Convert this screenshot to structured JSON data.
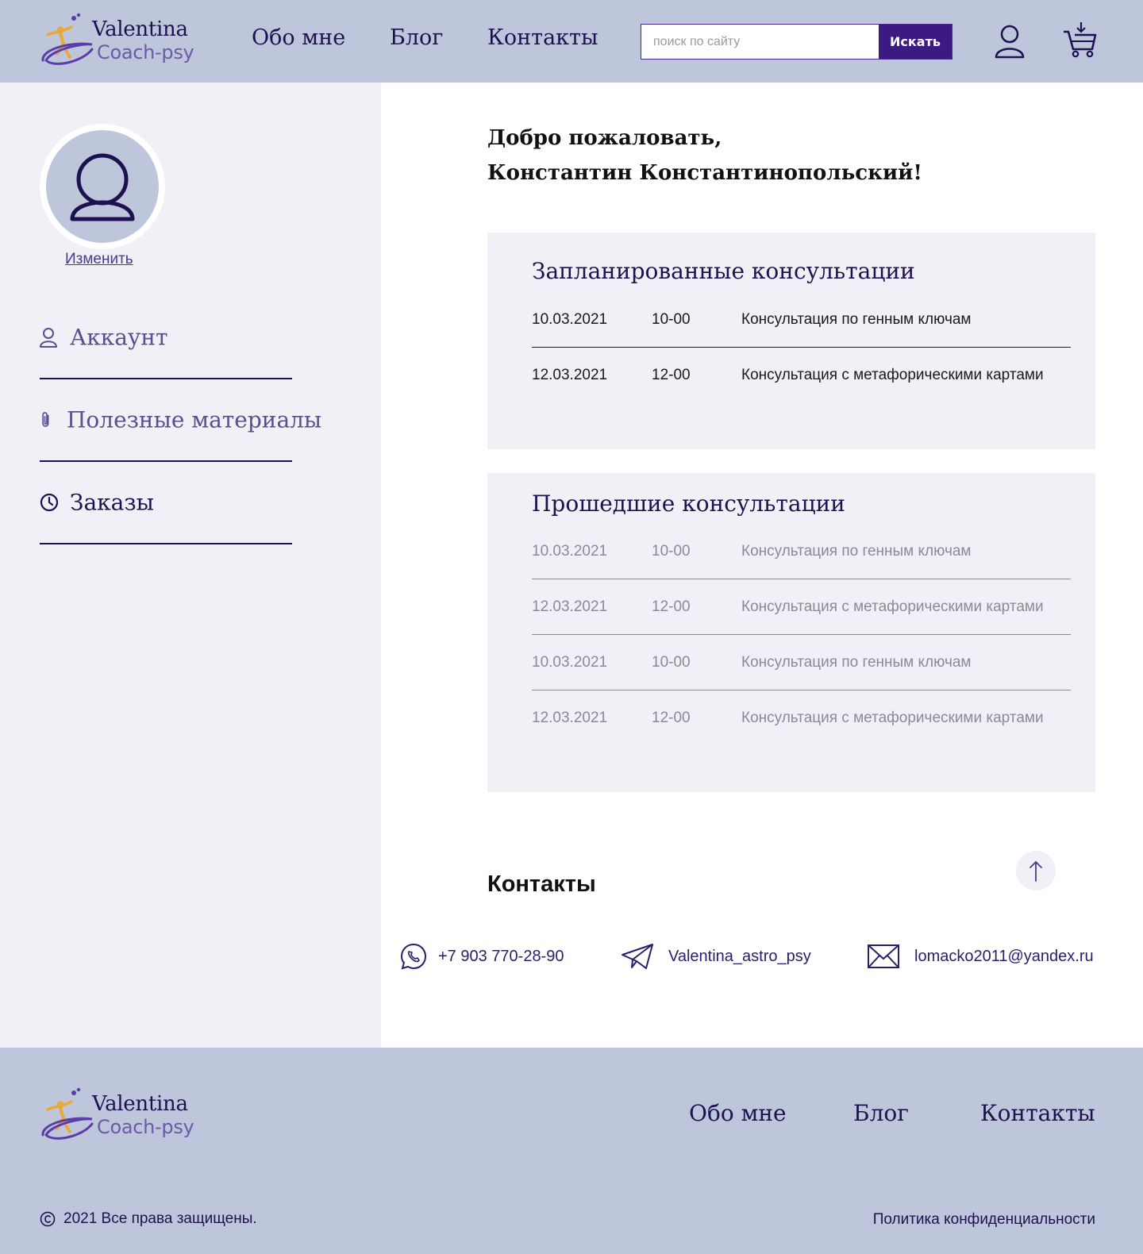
{
  "brand": {
    "line1": "Valentina",
    "line2": "Coach-psy"
  },
  "header": {
    "nav": [
      "Обо мне",
      "Блог",
      "Контакты"
    ],
    "search": {
      "placeholder": "поиск по сайту",
      "button": "Искать"
    },
    "icons": [
      "user-icon",
      "cart-icon"
    ]
  },
  "sidebar": {
    "change_label": "Изменить",
    "items": [
      {
        "label": "Аккаунт",
        "icon": "user-icon"
      },
      {
        "label": "Полезные материалы",
        "icon": "paperclip-icon"
      },
      {
        "label": "Заказы",
        "icon": "clock-icon"
      }
    ]
  },
  "main": {
    "welcome_line1": "Добро пожаловать,",
    "welcome_line2": "Константин Константинопольский!",
    "planned": {
      "title": "Запланированные консультации",
      "rows": [
        {
          "date": "10.03.2021",
          "time": "10-00",
          "name": "Консультация по генным ключам"
        },
        {
          "date": "12.03.2021",
          "time": "12-00",
          "name": "Консультация с метафорическими картами"
        }
      ]
    },
    "past": {
      "title": "Прошедшие консультации",
      "rows": [
        {
          "date": "10.03.2021",
          "time": "10-00",
          "name": "Консультация по генным ключам"
        },
        {
          "date": "12.03.2021",
          "time": "12-00",
          "name": "Консультация с метафорическими картами"
        },
        {
          "date": "10.03.2021",
          "time": "10-00",
          "name": "Консультация по генным ключам"
        },
        {
          "date": "12.03.2021",
          "time": "12-00",
          "name": "Консультация с метафорическими картами"
        }
      ]
    }
  },
  "contacts": {
    "title": "Контакты",
    "phone": "+7 903 770-28-90",
    "telegram": "Valentina_astro_psy",
    "email": "lomacko2011@yandex.ru"
  },
  "footer": {
    "nav": [
      "Обо мне",
      "Блог",
      "Контакты"
    ],
    "copyright": "2021  Все права защищены.",
    "privacy": "Политика конфиденциальности"
  },
  "colors": {
    "header_bg": "#bdc6da",
    "sidebar_bg": "#f0f0f6",
    "accent": "#3c1a84",
    "text_dark": "#1e1150",
    "muted_text": "#8a8a98"
  }
}
